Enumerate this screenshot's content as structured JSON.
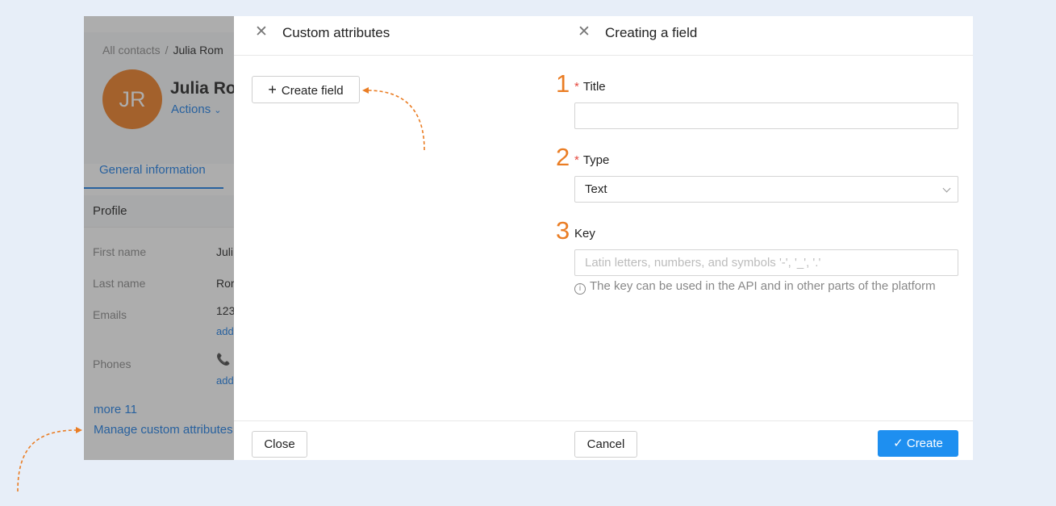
{
  "contact": {
    "breadcrumb_root": "All contacts",
    "breadcrumb_sep": "/",
    "breadcrumb_current": "Julia Rom",
    "initials": "JR",
    "name": "Julia Ron",
    "actions_label": "Actions",
    "tab_general": "General information",
    "section_profile": "Profile",
    "rows": [
      {
        "label": "First name",
        "value": "Juli"
      },
      {
        "label": "Last name",
        "value": "Ror"
      },
      {
        "label": "Emails",
        "value": "123",
        "link": "add"
      },
      {
        "label": "Phones",
        "value": "📞",
        "link": "add"
      }
    ],
    "more_link": "more 11",
    "manage_link": "Manage custom attributes"
  },
  "custom_attributes": {
    "title": "Custom attributes",
    "create_field_label": "Create field",
    "close_label": "Close"
  },
  "creating_field": {
    "title": "Creating a field",
    "fields": [
      {
        "step": "1",
        "label": "Title",
        "required": true,
        "value": ""
      },
      {
        "step": "2",
        "label": "Type",
        "required": true,
        "value": "Text"
      },
      {
        "step": "3",
        "label": "Key",
        "required": false,
        "placeholder": "Latin letters, numbers, and symbols '-', '_', '.'"
      }
    ],
    "key_hint": "The key can be used in the API and in other parts of the platform",
    "cancel_label": "Cancel",
    "create_label": "Create"
  },
  "colors": {
    "accent": "#1e8ff0",
    "link": "#1a7ce6",
    "step_number": "#ea7d24",
    "avatar": "#ee7d22",
    "required_mark": "#e5483e"
  }
}
